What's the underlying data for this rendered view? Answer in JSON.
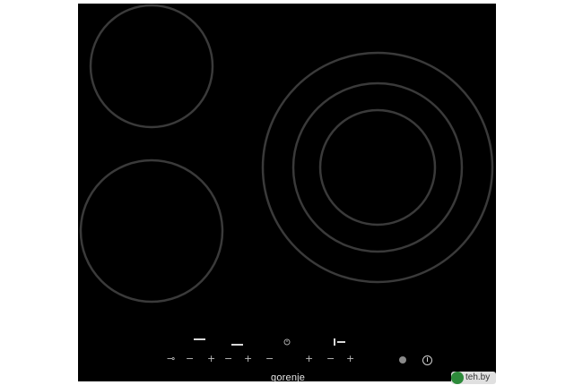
{
  "product": {
    "brand_text": "gorenje",
    "watermark_text": "teh.by",
    "surface_color": "#000000",
    "ring_color": "#3a3a3a"
  },
  "zones": [
    {
      "name": "rear-left-zone",
      "rings": 1
    },
    {
      "name": "front-left-zone",
      "rings": 1
    },
    {
      "name": "right-triple-zone",
      "rings": 3
    }
  ],
  "controls": {
    "lock_symbol": "⊸",
    "minus": "−",
    "plus": "+",
    "timer_icon": "clock-icon",
    "power_icon": "power-icon"
  }
}
